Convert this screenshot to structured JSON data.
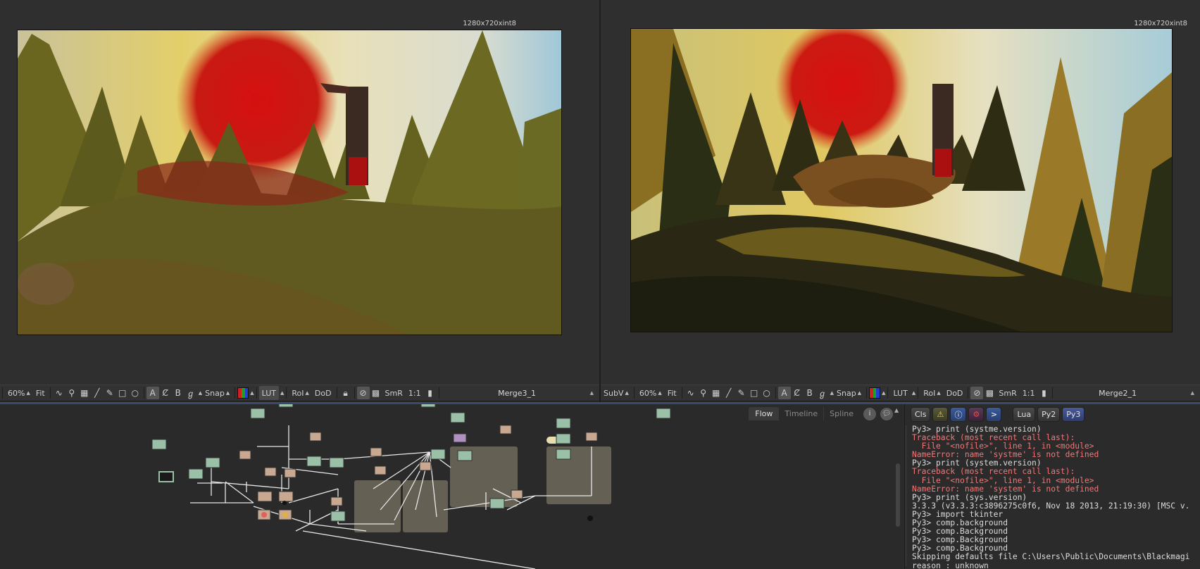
{
  "viewers": {
    "left": {
      "resolution": "1280x720xint8",
      "toolbar": {
        "zoom": "60%",
        "fit": "Fit",
        "snap": "Snap",
        "lut": "LUT",
        "roi": "RoI",
        "dod": "DoD",
        "smr": "SmR",
        "ratio": "1:1",
        "node_name": "Merge3_1"
      }
    },
    "right": {
      "resolution": "1280x720xint8",
      "toolbar": {
        "subview": "SubV",
        "zoom": "60%",
        "fit": "Fit",
        "snap": "Snap",
        "lut": "LUT",
        "roi": "RoI",
        "dod": "DoD",
        "smr": "SmR",
        "ratio": "1:1",
        "node_name": "Merge2_1"
      }
    }
  },
  "flow": {
    "tabs": [
      {
        "label": "Flow",
        "active": true
      },
      {
        "label": "Timeline",
        "active": false
      },
      {
        "label": "Spline",
        "active": false
      }
    ]
  },
  "console": {
    "buttons": {
      "clear": "Cls",
      "lua": "Lua",
      "py2": "Py2",
      "py3": "Py3"
    },
    "lines": [
      {
        "text": "Py3> print (systme.version)",
        "type": "normal"
      },
      {
        "text": "Traceback (most recent call last):",
        "type": "error"
      },
      {
        "text": "  File \"<nofile>\", line 1, in <module>",
        "type": "error"
      },
      {
        "text": "NameError: name 'systme' is not defined",
        "type": "error"
      },
      {
        "text": "Py3> print (system.version)",
        "type": "normal"
      },
      {
        "text": "Traceback (most recent call last):",
        "type": "error"
      },
      {
        "text": "  File \"<nofile>\", line 1, in <module>",
        "type": "error"
      },
      {
        "text": "NameError: name 'system' is not defined",
        "type": "error"
      },
      {
        "text": "Py3> print (sys.version)",
        "type": "normal"
      },
      {
        "text": "3.3.3 (v3.3.3:c3896275c0f6, Nov 18 2013, 21:19:30) [MSC v.",
        "type": "normal"
      },
      {
        "text": "Py3> import tkinter",
        "type": "normal"
      },
      {
        "text": "Py3> comp.background",
        "type": "normal"
      },
      {
        "text": "Py3> comp.Background",
        "type": "normal"
      },
      {
        "text": "Py3> comp.Background",
        "type": "normal"
      },
      {
        "text": "Py3> comp.Background",
        "type": "normal"
      },
      {
        "text": "Skipping defaults file C:\\Users\\Public\\Documents\\Blackmagi",
        "type": "normal"
      },
      {
        "text": "reason : unknown",
        "type": "normal"
      }
    ]
  },
  "colors": {
    "panel_bg": "#2b2b2b",
    "error_text": "#f07878",
    "normal_text": "#dcdcdc",
    "accent": "#3a4a6a"
  }
}
